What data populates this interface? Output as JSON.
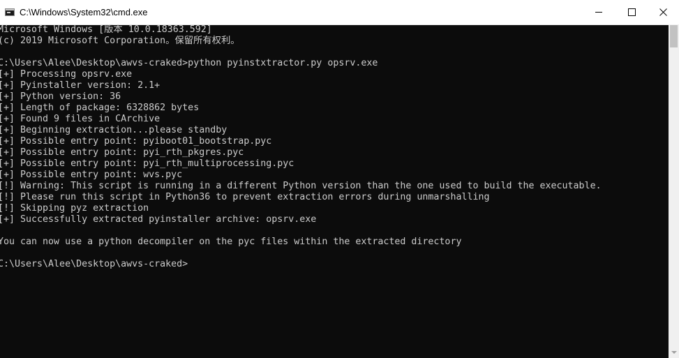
{
  "window": {
    "title": "C:\\Windows\\System32\\cmd.exe",
    "icon": "cmd-icon"
  },
  "controls": {
    "minimize": "minimize-icon",
    "maximize": "maximize-icon",
    "close": "close-icon"
  },
  "console": {
    "lines": [
      "Microsoft Windows [版本 10.0.18363.592]",
      "(c) 2019 Microsoft Corporation。保留所有权利。",
      "",
      "C:\\Users\\Alee\\Desktop\\awvs-craked>python pyinstxtractor.py opsrv.exe",
      "[+] Processing opsrv.exe",
      "[+] Pyinstaller version: 2.1+",
      "[+] Python version: 36",
      "[+] Length of package: 6328862 bytes",
      "[+] Found 9 files in CArchive",
      "[+] Beginning extraction...please standby",
      "[+] Possible entry point: pyiboot01_bootstrap.pyc",
      "[+] Possible entry point: pyi_rth_pkgres.pyc",
      "[+] Possible entry point: pyi_rth_multiprocessing.pyc",
      "[+] Possible entry point: wvs.pyc",
      "[!] Warning: This script is running in a different Python version than the one used to build the executable.",
      "[!] Please run this script in Python36 to prevent extraction errors during unmarshalling",
      "[!] Skipping pyz extraction",
      "[+] Successfully extracted pyinstaller archive: opsrv.exe",
      "",
      "You can now use a python decompiler on the pyc files within the extracted directory",
      "",
      "C:\\Users\\Alee\\Desktop\\awvs-craked>"
    ]
  },
  "colors": {
    "background": "#0c0c0c",
    "text": "#cccccc",
    "titlebar": "#ffffff"
  }
}
